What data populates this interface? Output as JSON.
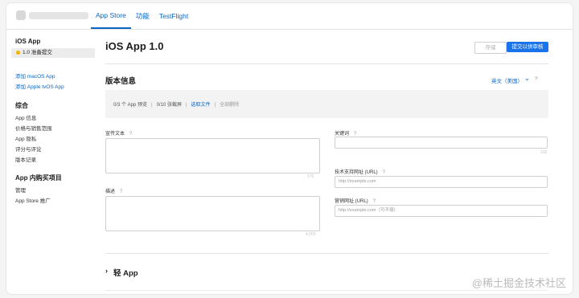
{
  "top_nav": {
    "tabs": [
      {
        "label": "App Store"
      },
      {
        "label": "功能"
      },
      {
        "label": "TestFlight"
      }
    ]
  },
  "sidebar": {
    "app_title": "iOS App",
    "version_label": "1.0 准备提交",
    "add_links": [
      "添加 macOS App",
      "添加 Apple tvOS App"
    ],
    "general_heading": "综合",
    "general_items": [
      "App 信息",
      "价格与销售范围",
      "App 隐私",
      "评分与评论",
      "版本记录"
    ],
    "iap_heading": "App 内购买项目",
    "iap_items": [
      "管理",
      "App Store 推广"
    ]
  },
  "main": {
    "page_title": "iOS App 1.0",
    "save_button": "存储",
    "submit_button": "提交以供审核",
    "version_info_title": "版本信息",
    "language": "英文（美国）",
    "help_mark": "?",
    "media": {
      "app_preview": "0/3 个 App 预览",
      "screenshots": "0/10 张截屏",
      "choose_files": "选取文件",
      "delete_all": "全部删除"
    },
    "promo_text": {
      "label": "宣传文本",
      "counter": "170"
    },
    "description": {
      "label": "描述",
      "counter": "4,000"
    },
    "keywords": {
      "label": "关键词",
      "counter": "100"
    },
    "support_url": {
      "label": "技术支持网址 (URL)",
      "placeholder": "http://example.com"
    },
    "marketing_url": {
      "label": "营销网址 (URL)",
      "placeholder": "http://example.com（可不填）"
    },
    "lite_app_title": "轻 App",
    "lite_arrow": "›"
  },
  "watermark": "@稀土掘金技术社区"
}
